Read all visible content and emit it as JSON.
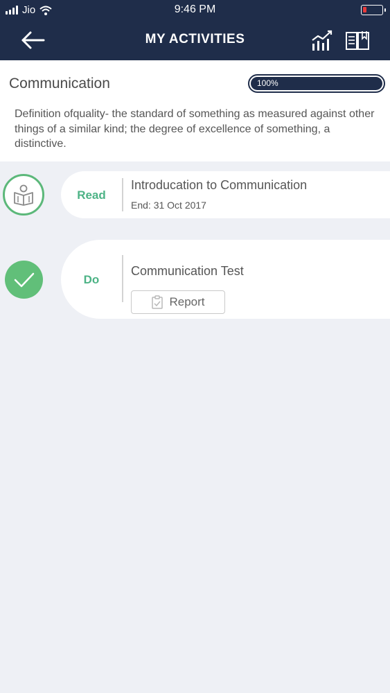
{
  "status_bar": {
    "carrier": "Jio",
    "time": "9:46 PM"
  },
  "navbar": {
    "title": "MY ACTIVITIES",
    "icons": [
      "back-arrow-icon",
      "chart-icon",
      "book-icon"
    ]
  },
  "topic": {
    "title": "Communication",
    "progress_label": "100%",
    "progress_value": 100,
    "description": "Definition ofquality- the standard of something as measured against other things of a similar kind; the degree of excellence of something, a distinctive."
  },
  "activities": [
    {
      "type": "Read",
      "title": "Introducation to Communication",
      "end_date": "End: 31 Oct 2017",
      "icon": "reading-icon"
    },
    {
      "type": "Do",
      "title": "Communication Test",
      "button_label": "Report",
      "icon": "checkmark-icon"
    }
  ],
  "colors": {
    "navy": "#1f2d4a",
    "green": "#5cb87a",
    "background": "#eef0f5"
  }
}
